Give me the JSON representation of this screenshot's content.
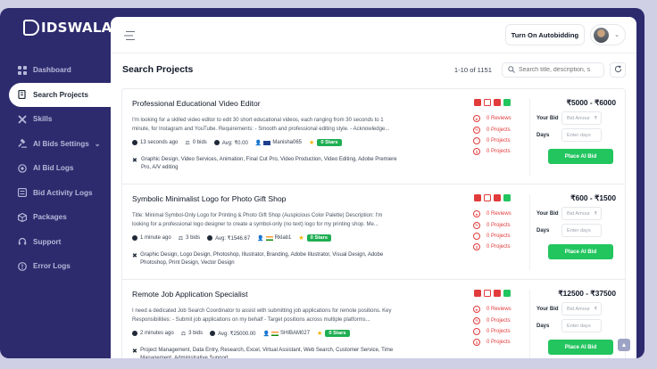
{
  "app": {
    "brand": "IDSWALA"
  },
  "sidebar": {
    "items": [
      {
        "label": "Dashboard",
        "icon": "grid-icon"
      },
      {
        "label": "Search Projects",
        "icon": "search-doc-icon"
      },
      {
        "label": "Skills",
        "icon": "tools-icon"
      },
      {
        "label": "AI Bids Settings",
        "icon": "gavel-icon",
        "has_chevron": true
      },
      {
        "label": "AI Bid Logs",
        "icon": "target-icon"
      },
      {
        "label": "Bid Activity Logs",
        "icon": "list-icon"
      },
      {
        "label": "Packages",
        "icon": "box-icon"
      },
      {
        "label": "Support",
        "icon": "headset-icon"
      },
      {
        "label": "Error Logs",
        "icon": "alert-icon"
      }
    ]
  },
  "topbar": {
    "autobid_label": "Turn On Autobidding"
  },
  "header": {
    "title": "Search Projects",
    "count": "1-10 of 1151",
    "search_placeholder": "Search title, description, s"
  },
  "labels": {
    "reviews": "0 Reviews",
    "projects": "0 Projects",
    "your_bid": "Your Bid",
    "days": "Days",
    "bid_placeholder": "Bid Amour",
    "bid_currency": "₹",
    "days_placeholder": "Enter days",
    "place_ai_bid": "Place AI Bid",
    "stars": "0 Stars"
  },
  "projects": [
    {
      "title": "Professional Educational Video Editor",
      "desc": "I'm looking for a skilled video editor to edit 30 short educational videos, each ranging from 30 seconds to 1 minute, for Instagram and YouTube. Requirements: - Smooth and professional editing style. - Acknowledge...",
      "time": "13 seconds ago",
      "bids": "0 bids",
      "avg": "Avg: ₹0.00",
      "user": "Manisha065",
      "skills": "Graphic Design, Video Services, Animation, Final Cut Pro, Video Production, Video Editing, Adobe Premiere Pro, A/V editing",
      "price": "₹5000 - ₹6000",
      "flag": "au"
    },
    {
      "title": "Symbolic Minimalist Logo for Photo Gift Shop",
      "desc": "Title: Minimal Symbol-Only Logo for Printing & Photo Gift Shop (Auspicious Color Palette) Description: I'm looking for a professional logo designer to create a symbol-only (no text) logo for my printing shop. Me...",
      "time": "1 minute ago",
      "bids": "3 bids",
      "avg": "Avg: ₹1546.67",
      "user": "Rklab1",
      "skills": "Graphic Design, Logo Design, Photoshop, Illustrator, Branding, Adobe Illustrator, Visual Design, Adobe Photoshop, Print Design, Vector Design",
      "price": "₹600 - ₹1500",
      "flag": "in"
    },
    {
      "title": "Remote Job Application Specialist",
      "desc": "I need a dedicated Job Search Coordinator to assist with submitting job applications for remote positions. Key Responsibilities: - Submit job applications on my behalf - Target positions across multiple platforms...",
      "time": "2 minutes ago",
      "bids": "3 bids",
      "avg": "Avg: ₹25000.00",
      "user": "SHIBAM027",
      "skills": "Project Management, Data Entry, Research, Excel, Virtual Assistant, Web Search, Customer Service, Time Management, Administrative Support",
      "price": "₹12500 - ₹37500",
      "flag": "in"
    }
  ],
  "colors": {
    "sidebar_bg": "#2d2b6e",
    "accent_green": "#22c55e",
    "alert_red": "#e13b3b"
  }
}
